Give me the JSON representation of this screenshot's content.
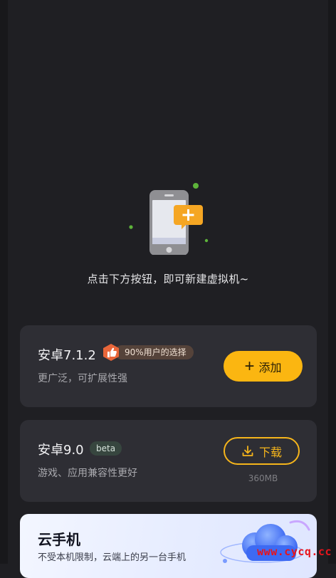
{
  "empty_state": {
    "hint": "点击下方按钮，即可新建虚拟机~"
  },
  "android7": {
    "title": "安卓7.1.2",
    "badge": "90%用户的选择",
    "desc": "更广泛，可扩展性强",
    "button": "添加"
  },
  "android9": {
    "title": "安卓9.0",
    "badge": "beta",
    "desc": "游戏、应用兼容性更好",
    "button": "下载",
    "size": "360MB"
  },
  "cloud_phone": {
    "title": "云手机",
    "subtitle": "不受本机限制，云端上的另一台手机"
  },
  "watermark": "www.cycq.cc",
  "colors": {
    "background": "#1f1f23",
    "card": "#2e2e34",
    "accent": "#fbb611",
    "badge_orange": "#e8663a"
  },
  "icons": [
    "phone-add-icon",
    "thumbs-up-icon",
    "plus-icon",
    "download-icon",
    "cloud-illustration"
  ]
}
